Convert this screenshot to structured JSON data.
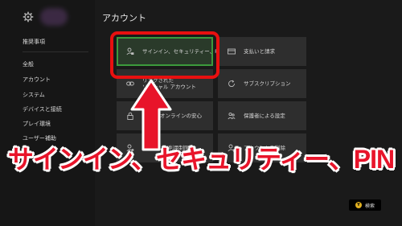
{
  "sidebar": {
    "items": [
      {
        "id": "recommended",
        "label": "推奨事項"
      },
      {
        "id": "general",
        "label": "全般"
      },
      {
        "id": "account",
        "label": "アカウント"
      },
      {
        "id": "system",
        "label": "システム"
      },
      {
        "id": "devices",
        "label": "デバイスと接続"
      },
      {
        "id": "preferences",
        "label": "プレイ環境"
      },
      {
        "id": "accessibility",
        "label": "ユーザー補助"
      }
    ]
  },
  "page": {
    "title": "アカウント"
  },
  "tiles": [
    {
      "label": "サインイン、セキュリティー、PIN",
      "icon": "person-lock-icon"
    },
    {
      "label": "支払いと請求",
      "icon": "credit-card-icon"
    },
    {
      "label": "リンクされた\nソーシャル アカウント",
      "icon": "link-icon"
    },
    {
      "label": "サブスクリプション",
      "icon": "subscription-icon"
    },
    {
      "label": "オンラインの安心",
      "icon": "lock-icon"
    },
    {
      "label": "保護者による設定",
      "icon": "family-icon"
    },
    {
      "label": "コンテンツ利用制限",
      "icon": "content-icon"
    },
    {
      "label": "アカウントを削除",
      "icon": "person-remove-icon"
    }
  ],
  "caption": "サインイン、セキュリティー、PIN",
  "footer": {
    "button_icon": "Y",
    "search_label": "検索"
  },
  "colors": {
    "highlight": "#e81010",
    "focus": "#3c9a3c",
    "caption": "#e8142a"
  }
}
